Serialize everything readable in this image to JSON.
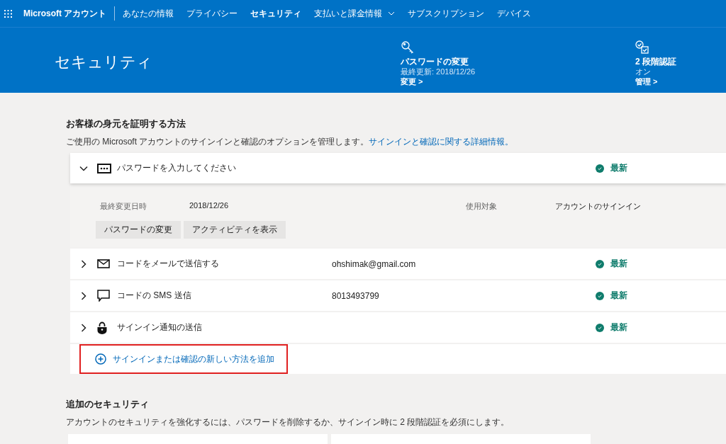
{
  "nav": {
    "brand": "Microsoft アカウント",
    "items": [
      {
        "label": "あなたの情報",
        "selected": false,
        "dropdown": false
      },
      {
        "label": "プライバシー",
        "selected": false,
        "dropdown": false
      },
      {
        "label": "セキュリティ",
        "selected": true,
        "dropdown": false
      },
      {
        "label": "支払いと課金情報",
        "selected": false,
        "dropdown": true
      },
      {
        "label": "サブスクリプション",
        "selected": false,
        "dropdown": false
      },
      {
        "label": "デバイス",
        "selected": false,
        "dropdown": false
      }
    ]
  },
  "hero": {
    "title": "セキュリティ",
    "quick_links": [
      {
        "kind": "key",
        "title": "パスワードの変更",
        "subtitle": "最終更新: 2018/12/26",
        "link": "変更 >"
      },
      {
        "kind": "two-step",
        "title": "2 段階認証",
        "subtitle": "オン",
        "link": "管理 >"
      }
    ]
  },
  "identity": {
    "heading": "お客様の身元を証明する方法",
    "description": "ご使用の Microsoft アカウントのサインインと確認のオプションを管理します。",
    "link": "サインインと確認に関する詳細情報。",
    "methods": [
      {
        "kind": "password",
        "label": "パスワードを入力してください",
        "status": "最新",
        "expanded": true,
        "details": [
          {
            "label": "最終変更日時",
            "value": "2018/12/26"
          },
          {
            "label": "使用対象",
            "value": "アカウントのサインイン"
          }
        ],
        "actions": [
          "パスワードの変更",
          "アクティビティを表示"
        ]
      },
      {
        "kind": "email",
        "label": "コードをメールで送信する",
        "value": "ohshimak@gmail.com",
        "status": "最新",
        "expanded": false
      },
      {
        "kind": "sms",
        "label": "コードの SMS 送信",
        "value": "8013493799",
        "status": "最新",
        "expanded": false
      },
      {
        "kind": "notification",
        "label": "サインイン通知の送信",
        "status": "最新",
        "expanded": false
      }
    ],
    "add_method": {
      "label": "サインインまたは確認の新しい方法を追加",
      "highlighted": true
    }
  },
  "additional": {
    "heading": "追加のセキュリティ",
    "description": "アカウントのセキュリティを強化するには、パスワードを削除するか、サインイン時に 2 段階認証を必須にします。"
  }
}
